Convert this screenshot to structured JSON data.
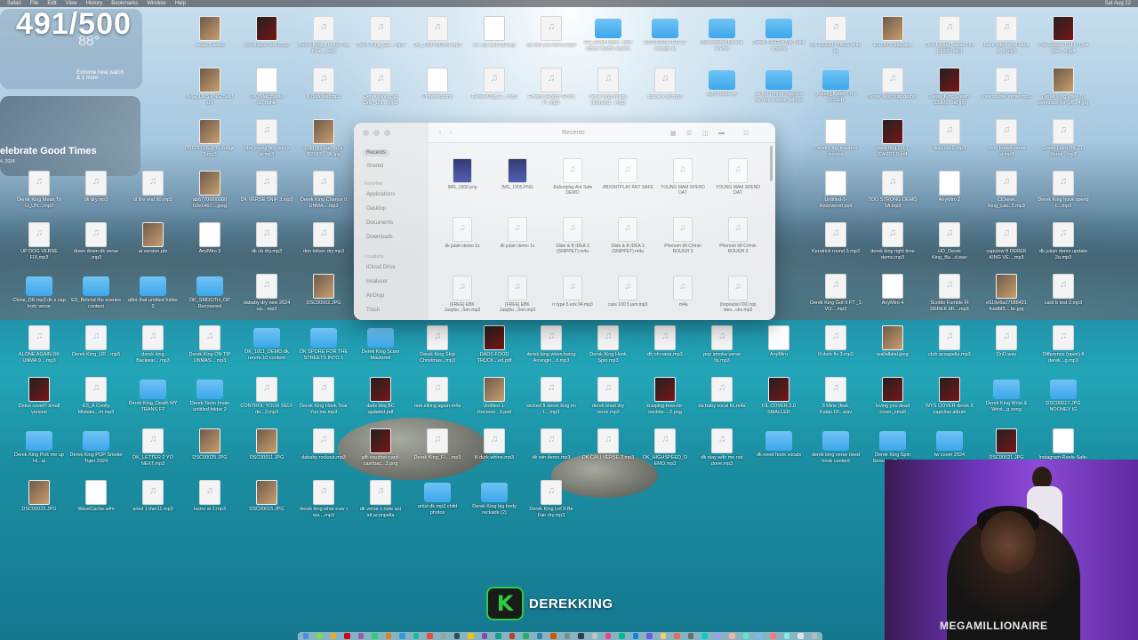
{
  "menubar": {
    "app": "Safari",
    "items": [
      "File",
      "Edit",
      "View",
      "History",
      "Bookmarks",
      "Window",
      "Help"
    ],
    "clock": "Sat Aug 22"
  },
  "overlay": {
    "counter": "491/500"
  },
  "weather_widget": {
    "temp": "88°",
    "summary": "Extreme heat watch",
    "more": "& 1 more"
  },
  "photos_widget": {
    "title": "elebrate Good Times",
    "subtitle": "4, 2024"
  },
  "finder": {
    "title": "Recents",
    "sidebar": {
      "favorites_header": "Favorites",
      "favorites": [
        "Recents",
        "Shared",
        "Applications",
        "Desktop",
        "Documents",
        "Downloads"
      ],
      "locations_header": "Locations",
      "locations": [
        "iCloud Drive",
        "localuser",
        "AirDrop",
        "Trash"
      ]
    },
    "items": [
      {
        "name": "IMG_1906.png",
        "kind": "phone"
      },
      {
        "name": "IMG_1905.PNG",
        "kind": "phone"
      },
      {
        "name": "Jbdontplay Ant Safe DEMO",
        "kind": "audio"
      },
      {
        "name": "JBDONTPLAY ANT SAFE",
        "kind": "audio"
      },
      {
        "name": "YOUNG MAM SPEND DAT",
        "kind": "audio"
      },
      {
        "name": "YOUNG MAM SPEND DAT",
        "kind": "audio"
      },
      {
        "name": "dk julain demo 1z",
        "kind": "audio"
      },
      {
        "name": "dk julain demo 1z",
        "kind": "audio"
      },
      {
        "name": "Slide & B IDEA 3 (SNIPPET).m4a",
        "kind": "audio"
      },
      {
        "name": "Slide & B IDEA 3 (SNIPPET).m4a",
        "kind": "audio"
      },
      {
        "name": "Phenom 98 C#min ROUGH 3",
        "kind": "audio"
      },
      {
        "name": "Phenom 98 C#min ROUGH 3",
        "kind": "audio"
      },
      {
        "name": "[FREE] EBK Jaaybo...Son.mp3",
        "kind": "audio"
      },
      {
        "name": "[FREE] EBK Jaaybo...Son.mp3",
        "kind": "audio"
      },
      {
        "name": "rr type 5 eck 94.mp3",
        "kind": "audio"
      },
      {
        "name": "cass 100 5 jam.mp3",
        "kind": "audio"
      },
      {
        "name": ".m4a",
        "kind": "audio"
      },
      {
        "name": "(hopoutso700) top steo...cko.mp3",
        "kind": "audio"
      }
    ]
  },
  "desktop_icons": [
    {
      "label": "mega 2.webp",
      "kind": "image"
    },
    {
      "label": "thumbbbb ns!8 2222",
      "kind": "dark"
    },
    {
      "label": "Derek King_Loving You Dea....mp3",
      "kind": "file"
    },
    {
      "label": "Derek King_Co....mp3",
      "kind": "file"
    },
    {
      "label": "DK_TRIP DEMO.mp3",
      "kind": "file"
    },
    {
      "label": "on. my soul 310.zip",
      "kind": "doc"
    },
    {
      "label": "dk with you demo.mp3",
      "kind": "file"
    },
    {
      "label": "ES_Dwell Upon - new album theme assets",
      "kind": "folder"
    },
    {
      "label": "DSC00009.JPG 21 savage ai",
      "kind": "folder"
    },
    {
      "label": "Not inspired by true events",
      "kind": "folder"
    },
    {
      "label": "Derek KING in My Truck scarl ai",
      "kind": "folder"
    },
    {
      "label": "DK DEMO I TAKE write to",
      "kind": "file"
    },
    {
      "label": "ESTAYS baq.app",
      "kind": "image"
    },
    {
      "label": "Derek King Speak ON DEMO.mp3",
      "kind": "file"
    },
    {
      "label": "back ddg verse back 4_3.mp3",
      "kind": "file"
    },
    {
      "label": "Pop Smoke Put In One She...4.pdf",
      "kind": "dark"
    },
    {
      "label": "IMG_1905 PNG Build Up",
      "kind": "image"
    },
    {
      "label": "DK (Mac Book) st...nofile",
      "kind": "doc"
    },
    {
      "label": "lil durk test.mp3",
      "kind": "file"
    },
    {
      "label": "Derek King_Big One_UN....mp3",
      "kind": "file"
    },
    {
      "label": "Pinterest.html",
      "kind": "doc"
    },
    {
      "label": "Derek King_C....mp3",
      "kind": "file"
    },
    {
      "label": "Fmajor 94bpm 'Good F...mp3",
      "kind": "file"
    },
    {
      "label": "derek king yellow diamond....mp3",
      "kind": "file"
    },
    {
      "label": "zza ai x dk.mp3",
      "kind": "file"
    },
    {
      "label": "light house dk",
      "kind": "folder"
    },
    {
      "label": "dk the runner inspired by true events deluxe",
      "kind": "folder"
    },
    {
      "label": "[FREE] Kalan FrFr COVER",
      "kind": "folder"
    },
    {
      "label": "Derek King (rap demo)",
      "kind": "file"
    },
    {
      "label": "Derek King_Death 333k!b...ad.jpg",
      "kind": "dark"
    },
    {
      "label": "love to lose verse.mp3",
      "kind": "file"
    },
    {
      "label": "Derek King Love To overdose-for-gift...4.jpg",
      "kind": "image"
    },
    {
      "label": "DSC00016.JPG dodge 3.mp3",
      "kind": "image"
    },
    {
      "label": "nba young boy jeezy ai.mp3",
      "kind": "file"
    },
    {
      "label": "01fd7691be5fb2a 8f2983....9b.jpg",
      "kind": "image"
    },
    {
      "label": "Derek King masters invoice",
      "kind": "doc"
    },
    {
      "label": "dads bbq GIFT CARD2.0.pdf",
      "kind": "dark"
    },
    {
      "label": "doja cat 2.mp3",
      "kind": "file"
    },
    {
      "label": "chris brown verse ai.mp3",
      "kind": "file"
    },
    {
      "label": "Green Light DK CO Verse...mp3",
      "kind": "file"
    },
    {
      "label": "Derek King Mean To U_UN....mp3",
      "kind": "file"
    },
    {
      "label": "dk dry.mp3",
      "kind": "file"
    },
    {
      "label": "til the end 90.mp3",
      "kind": "file"
    },
    {
      "label": "ab67706f00000 02e1467....jpeg",
      "kind": "image"
    },
    {
      "label": "DK VERSE SNIP 3.mp3",
      "kind": "file"
    },
    {
      "label": "Derek King Chance It UNMA....mp3",
      "kind": "file"
    },
    {
      "label": "Untitled-1-Recovered.psd",
      "kind": "doc"
    },
    {
      "label": "TOO STRONG DEMO 1A.mp3",
      "kind": "file"
    },
    {
      "label": "AnyMiro 2",
      "kind": "doc"
    },
    {
      "label": "ClDerek King_Lau..2.mp3",
      "kind": "file"
    },
    {
      "label": "Derek King hook spend t....mp3",
      "kind": "file"
    },
    {
      "label": "UP DOG VERSE FIX.mp3",
      "kind": "file"
    },
    {
      "label": "down down dk verse .mp3",
      "kind": "file"
    },
    {
      "label": "ai version.ptx",
      "kind": "image"
    },
    {
      "label": "AnyMiro 3",
      "kind": "doc"
    },
    {
      "label": "dk cb dry.mp3",
      "kind": "file"
    },
    {
      "label": "don toliver dry.mp3",
      "kind": "file"
    },
    {
      "label": "Kendrick round 3.mp3",
      "kind": "file"
    },
    {
      "label": "derek king right time demo.mp3",
      "kind": "file"
    },
    {
      "label": "HD_Derek King_Ba...d.wav",
      "kind": "file"
    },
    {
      "label": "capolow ft DEREK KING VE....mp3",
      "kind": "file"
    },
    {
      "label": "dk julain demo update 2a.mp3",
      "kind": "file"
    },
    {
      "label": "Clone_DK.mp3 dk x cap lexic verse",
      "kind": "folder"
    },
    {
      "label": "ES_Behind the scenes content",
      "kind": "folder"
    },
    {
      "label": "after that untitled folder 2",
      "kind": "folder"
    },
    {
      "label": "DK_SMOOTH_OP Recovered",
      "kind": "folder"
    },
    {
      "label": "dababy dry new 2024 up....mp3",
      "kind": "file"
    },
    {
      "label": "DSC00002.JPG",
      "kind": "image"
    },
    {
      "label": "Derek King Got It FT _1 VO....mp3",
      "kind": "file"
    },
    {
      "label": "AnyMiro 4",
      "kind": "doc"
    },
    {
      "label": "Scottie Fumble Ft DEREK MI....mp3",
      "kind": "file"
    },
    {
      "label": "e516e6a27588421 fcedbf2....bc.jpg",
      "kind": "image"
    },
    {
      "label": "card b test 2.mp3",
      "kind": "file"
    },
    {
      "label": "ALONE AGAIN DK UNMA 9....mp3",
      "kind": "file"
    },
    {
      "label": "Derek King_UP....mp3",
      "kind": "file"
    },
    {
      "label": "derek king Backwar....mp3",
      "kind": "file"
    },
    {
      "label": "Derek King ON TIP UNMAS....mp3",
      "kind": "file"
    },
    {
      "label": "DK_1011_DEMO dk rerere 10 content",
      "kind": "folder"
    },
    {
      "label": "DK SPORE FOR THE STREETS INTO 1",
      "kind": "folder"
    },
    {
      "label": "Derek King Scars Mastered",
      "kind": "folder"
    },
    {
      "label": "Derek King Skip Christmas...mp3",
      "kind": "file"
    },
    {
      "label": "DADS FOOD TRUCK...ed.pdf",
      "kind": "dark"
    },
    {
      "label": "derek king when being Arrangin...d.mp3",
      "kind": "file"
    },
    {
      "label": "Derek King Hook Spin.mp3",
      "kind": "file"
    },
    {
      "label": "dk oh nana.mp3",
      "kind": "file"
    },
    {
      "label": "pop smoke verse fix.mp3",
      "kind": "file"
    },
    {
      "label": "AnyMiro",
      "kind": "doc"
    },
    {
      "label": "lil durk fix 3.mp3",
      "kind": "file"
    },
    {
      "label": "wallallalal.jpeg",
      "kind": "image"
    },
    {
      "label": "club acaapella.mp3",
      "kind": "file"
    },
    {
      "label": "DnD.wav",
      "kind": "file"
    },
    {
      "label": "Difference (open) ft derek...g.mp3",
      "kind": "file"
    },
    {
      "label": "Delux cover!! small version",
      "kind": "dark"
    },
    {
      "label": "ES_A Coolly Mistake...rtr.mp3",
      "kind": "file"
    },
    {
      "label": "Derek King_Death MY TRANS FT",
      "kind": "folder"
    },
    {
      "label": "Derek Tacto (male untitled folder 2",
      "kind": "folder"
    },
    {
      "label": "CONTROL YOUR SELF de...2.mp3",
      "kind": "file"
    },
    {
      "label": "Derek King Hook Tear You me.mp3",
      "kind": "file"
    },
    {
      "label": "dads bbq BC updated.pdf",
      "kind": "dark"
    },
    {
      "label": "met alking again.m4a",
      "kind": "file"
    },
    {
      "label": "Untitled-1-Recover...3.psd",
      "kind": "image"
    },
    {
      "label": "wicked ft derek king im t....mp3",
      "kind": "file"
    },
    {
      "label": "derek blast dry verse.mp3",
      "kind": "file"
    },
    {
      "label": "kissping-bow-tie-necktie-...2.png",
      "kind": "dark"
    },
    {
      "label": "da baby vocal fix.m4a",
      "kind": "file"
    },
    {
      "label": "FIL COVER 2.0 SMALLER",
      "kind": "dark"
    },
    {
      "label": "8 Mine (feat. Kalan.FF...wav",
      "kind": "file"
    },
    {
      "label": "loving you dead cover_small",
      "kind": "dark"
    },
    {
      "label": "WYS COVER derek X capolow album",
      "kind": "dark"
    },
    {
      "label": "Derek King Wrist & Wrist...g song",
      "kind": "folder"
    },
    {
      "label": "DSC00017.JPG NOONEY IG",
      "kind": "folder"
    },
    {
      "label": "Derek King Pick me up Hi...ai",
      "kind": "folder"
    },
    {
      "label": "Derek King POP Smoke Tiger 2024",
      "kind": "folder"
    },
    {
      "label": "DK_LETTER 2 YO NEXT.mp3",
      "kind": "file"
    },
    {
      "label": "DSC00025.JPG",
      "kind": "image"
    },
    {
      "label": "DSC00011.JPG",
      "kind": "image"
    },
    {
      "label": "dababy rockout.mp3",
      "kind": "file"
    },
    {
      "label": "gift-voucher-card-cashbac...3.png",
      "kind": "dark"
    },
    {
      "label": "Derek King_F.I....mp3",
      "kind": "file"
    },
    {
      "label": "lil durk whine.mp3",
      "kind": "file"
    },
    {
      "label": "dk win demo.mp3",
      "kind": "file"
    },
    {
      "label": "DK CALI VERSE 2.mp3",
      "kind": "file"
    },
    {
      "label": "DK_HIGHSPEED_D EMO.mp3",
      "kind": "file"
    },
    {
      "label": "dk stay with me not done.mp3",
      "kind": "file"
    },
    {
      "label": "dk need hook vocals",
      "kind": "folder"
    },
    {
      "label": "derek king verse need hook content",
      "kind": "folder"
    },
    {
      "label": "Derek King Spin Sessions Backups",
      "kind": "folder"
    },
    {
      "label": "tw cover 2024",
      "kind": "folder"
    },
    {
      "label": "DSC00021.JPG",
      "kind": "dark"
    },
    {
      "label": "Instagram-Reels-Safe-Zo...1.webp",
      "kind": "doc"
    },
    {
      "label": "DSC00023.JPG",
      "kind": "image"
    },
    {
      "label": "WaveCache.wfm",
      "kind": "doc"
    },
    {
      "label": "artist 1 ther11.mp3",
      "kind": "file"
    },
    {
      "label": "lucire ai 2.mp3",
      "kind": "file"
    },
    {
      "label": "DSC00015.JPG",
      "kind": "image"
    },
    {
      "label": "derek king what ever i wa....mp3",
      "kind": "file"
    },
    {
      "label": "dk verse x nate act alt.aconpella",
      "kind": "file"
    },
    {
      "label": "artist dk.mp3 child photos",
      "kind": "folder"
    },
    {
      "label": "Derek King big body reckads (2)",
      "kind": "folder"
    },
    {
      "label": "Derek King Let It Be Fair dry.mp3",
      "kind": "file"
    }
  ],
  "webcam": {
    "shirt_text": "MEGAMILLIONAIRE"
  },
  "brand": {
    "logo_letter": "K",
    "name": "DEREKKING"
  }
}
